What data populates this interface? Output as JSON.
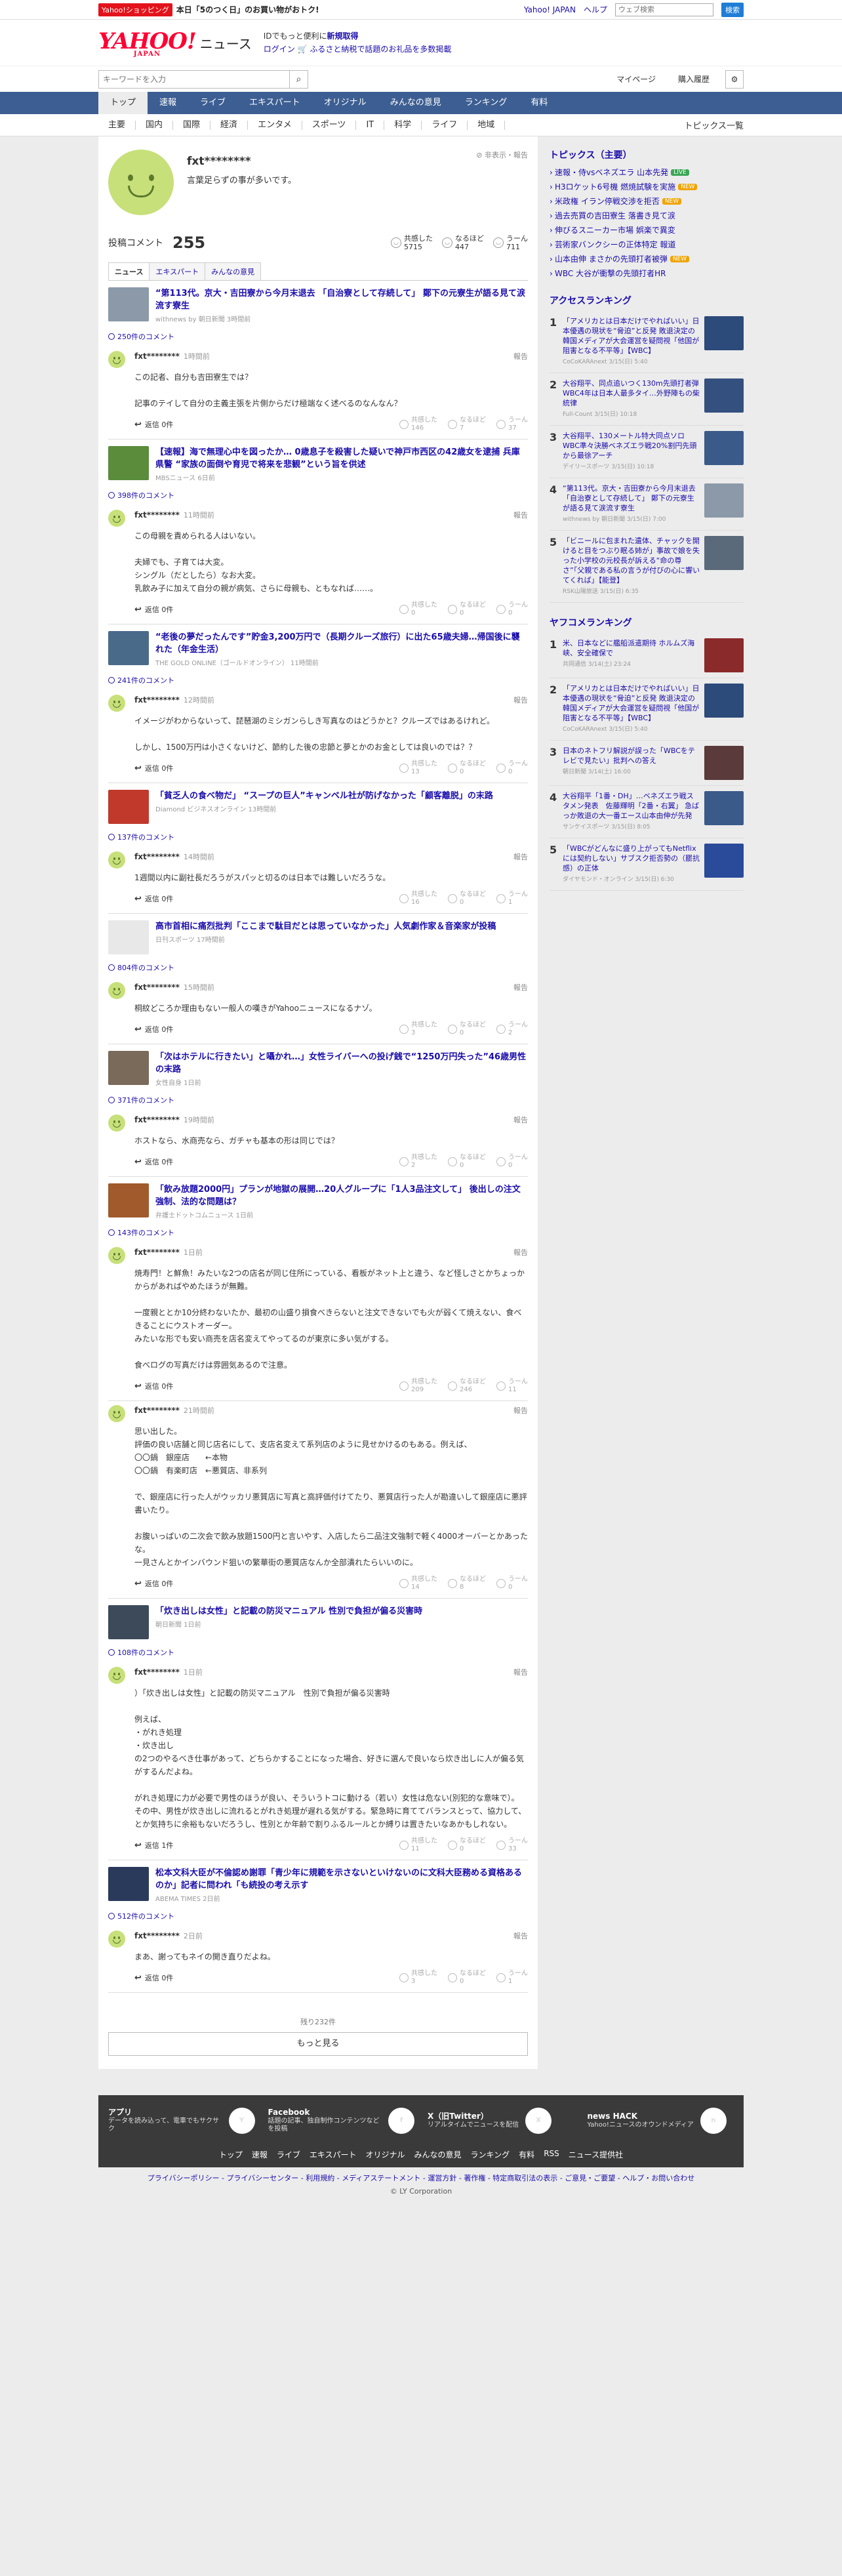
{
  "topbar": {
    "shop_tag": "Yahoo!ショッピング",
    "promo": "本日「5のつく日」のお買い物がおトク!",
    "links": [
      "Yahoo! JAPAN",
      "ヘルプ"
    ],
    "search_placeholder": "ウェブ検索",
    "search_btn": "検索"
  },
  "header": {
    "logo": "YAHOO!",
    "logo_sub": "JAPAN",
    "section": "ニュース",
    "login_line1_pre": "IDでもっと便利に",
    "login_line1_link": "新規取得",
    "login_line2_link": "ログイン",
    "login_line2_rest": "ふるさと納税で話題のお礼品を多数掲載"
  },
  "search": {
    "placeholder": "キーワードを入力",
    "mypage": "マイページ",
    "history": "購入履歴"
  },
  "nav": [
    "トップ",
    "速報",
    "ライブ",
    "エキスパート",
    "オリジナル",
    "みんなの意見",
    "ランキング",
    "有料"
  ],
  "subnav": [
    "主要",
    "国内",
    "国際",
    "経済",
    "エンタメ",
    "スポーツ",
    "IT",
    "科学",
    "ライフ",
    "地域"
  ],
  "subnav_right": "トピックス一覧",
  "profile": {
    "name": "fxt********",
    "bio": "言葉足らずの事が多いです。",
    "report": "非表示・報告",
    "count_label": "投稿コメント",
    "count": "255"
  },
  "profile_reacts": [
    {
      "label": "共感した",
      "value": "5715"
    },
    {
      "label": "なるほど",
      "value": "447"
    },
    {
      "label": "うーん",
      "value": "711"
    }
  ],
  "comment_tabs": [
    "ニュース",
    "エキスパート",
    "みんなの意見"
  ],
  "react_labels": [
    "共感した",
    "なるほど",
    "うーん"
  ],
  "entries": [
    {
      "title": "“第113代。京大・吉田寮から今月末退去 「自治寮として存続して」 鄭下の元寮生が語る見て涙流す寮生",
      "source": "withnews by 朝日新聞 3時間前",
      "thumb": "#8b99a8",
      "count": "250件のコメント",
      "user": "fxt********",
      "time": "1時間前",
      "text": "この記者、自分も吉田寮生では？\n\n記事のテイして自分の主義主張を片側からだけ極端なく述べるのなんなん？",
      "replies": "返信 0件",
      "r": [
        "146",
        "7",
        "37"
      ]
    },
    {
      "title": "【速報】海で無理心中を図ったか… 0歳息子を殺害した疑いで神戸市西区の42歳女を逮捕 兵庫県警 “家族の面倒や育児で将来を悲観”という旨を供述",
      "source": "MBSニュース 6日前",
      "thumb": "#5a8c3c",
      "count": "398件のコメント",
      "user": "fxt********",
      "time": "11時間前",
      "text": "この母親を責められる人はいない。\n\n夫婦でも、子育ては大変。\nシングル（だとしたら）なお大変。\n乳飲み子に加えて自分の親が病気、さらに母親も、ともなれば……。",
      "replies": "返信 0件",
      "r": [
        "0",
        "0",
        "0"
      ]
    },
    {
      "title": "“老後の夢だったんです”貯金3,200万円で（長期クルーズ旅行）に出た65歳夫婦…帰国後に襲れた（年金生活）",
      "source": "THE GOLD ONLINE（ゴールドオンライン） 11時間前",
      "thumb": "#4a6a8a",
      "count": "241件のコメント",
      "user": "fxt********",
      "time": "12時間前",
      "text": "イメージがわからないって、琵琶湖のミシガンらしき写真なのはどうかと？クルーズではあるけれど。\n\nしかし、1500万円は小さくないけど、節約した後の忠節と夢とかのお金としては良いのでは？？",
      "replies": "返信 0件",
      "r": [
        "13",
        "0",
        "0"
      ]
    },
    {
      "title": "「貧乏人の食べ物だ」 “スープの巨人”キャンベル社が防げなかった「顧客離脱」の末路",
      "source": "Diamond ビジネスオンライン 13時間前",
      "thumb": "#c0392b",
      "count": "137件のコメント",
      "user": "fxt********",
      "time": "14時間前",
      "text": "1週間以内に副社長だろうがスパッと切るのは日本では難しいだろうな。",
      "replies": "返信 0件",
      "r": [
        "16",
        "0",
        "1"
      ]
    },
    {
      "title": "高市首相に痛烈批判「ここまで駄目だとは思っていなかった」人気劇作家＆音楽家が投稿",
      "source": "日刊スポーツ 17時間前",
      "thumb": "#e8e8e8",
      "count": "804件のコメント",
      "user": "fxt********",
      "time": "15時間前",
      "text": "桐紋どころか理由もない一般人の嘆きがYahooニュースになるナゾ。",
      "replies": "返信 0件",
      "r": [
        "3",
        "0",
        "2"
      ]
    },
    {
      "title": "「次はホテルに行きたい」と囁かれ…」女性ライバーへの投げ銭で“1250万円失った”46歳男性の末路",
      "source": "女性自身 1日前",
      "thumb": "#7a6a5a",
      "count": "371件のコメント",
      "user": "fxt********",
      "time": "19時間前",
      "text": "ホストなら、水商売なら、ガチャも基本の形は同じでは？",
      "replies": "返信 0件",
      "r": [
        "2",
        "0",
        "0"
      ]
    },
    {
      "title": "「飲み放題2000円」プランが地獄の展開…20人グループに「1人3品注文して」 後出しの注文強制、法的な問題は？",
      "source": "弁護士ドットコムニュース 1日前",
      "thumb": "#a05a2c",
      "count": "143件のコメント",
      "user": "fxt********",
      "time": "1日前",
      "text": "焼寿門！と鮮魚！みたいな2つの店名が同じ住所にっている、看板がネット上と違う、など怪しさとかちょっかからがあればやめたほうが無難。\n\n一度親ととか10分終わないたか、最初の山盛り損食べきらないと注文できないでも火が弱くて焼えない、食べきることにウストオーダー。\nみたいな形でも安い商売を店名変えてやってるのが東京に多い気がする。\n\n食べログの写真だけは雰囲気あるので注意。",
      "replies": "返信 0件",
      "r": [
        "209",
        "246",
        "11"
      ]
    },
    {
      "title": "",
      "source": "",
      "thumb": "",
      "count": "",
      "user": "fxt********",
      "time": "21時間前",
      "text": "思い出した。\n評価の良い店舗と同じ店名にして、支店名変えて系列店のように見せかけるのもある。例えば、\n〇〇鍋　銀座店　　←本物\n〇〇鍋　有楽町店　←悪質店、非系列\n\nで、銀座店に行った人がウッカリ悪質店に写真と高評価付けてたり、悪質店行った人が勘違いして銀座店に悪評書いたり。\n\nお腹いっぱいの二次会で飲み放題1500円と言いやす、入店したら二品注文強制で軽く4000オーバーとかあったな。\n一見さんとかインバウンド狙いの繁華街の悪質店なんか全部潰れたらいいのに。",
      "replies": "返信 0件",
      "r": [
        "14",
        "8",
        "0"
      ]
    },
    {
      "title": "「炊き出しは女性」と記載の防災マニュアル 性別で負担が偏る災害時",
      "source": "朝日新聞 1日前",
      "thumb": "#3c4a5a",
      "count": "108件のコメント",
      "user": "fxt********",
      "time": "1日前",
      "text": "）「炊き出しは女性」と記載の防災マニュアル　性別で負担が偏る災害時\n\n例えば、\n・がれき処理\n・炊き出し\nの2つのやるべき仕事があって、どちらかすることになった場合、好きに選んで良いなら炊き出しに人が偏る気がするんだよね。\n\nがれき処理に力が必要で男性のほうが良い、そういうトコに動ける（若い）女性は危ない(別犯的な意味で）。\nその中、男性が炊き出しに流れるとがれき処理が遅れる気がする。緊急時に育ててバランスとって、協力して、とか気持ちに余裕もないだろうし、性別とか年齢で割りふるルールとか縛りは置きたいなあかもしれない。",
      "replies": "返信 1件",
      "r": [
        "11",
        "0",
        "33"
      ]
    },
    {
      "title": "松本文科大臣が不倫認め謝罪「青少年に規範を示さないといけないのに文科大臣務める資格あるのか」記者に問われ「も続投の考え示す",
      "source": "ABEMA TIMES 2日前",
      "thumb": "#2a3a5a",
      "count": "512件のコメント",
      "user": "fxt********",
      "time": "2日前",
      "text": "まあ、謝ってもネイの開き直りだよね。",
      "replies": "返信 0件",
      "r": [
        "3",
        "0",
        "1"
      ]
    }
  ],
  "more": {
    "remaining": "残り232件",
    "button": "もっと見る"
  },
  "topics": {
    "title": "トピックス（主要）",
    "items": [
      {
        "t": "速報・侍vsベネズエラ 山本先発",
        "b": "LIVE",
        "c": "#3aa655"
      },
      {
        "t": "H3ロケット6号機 燃焼試験を実施",
        "b": "NEW",
        "c": "#f0a400"
      },
      {
        "t": "米政権 イラン停戦交渉を拒否",
        "b": "NEW",
        "c": "#f0a400"
      },
      {
        "t": "過去売買の吉田寮生 落書き見て涙",
        "b": "",
        "c": ""
      },
      {
        "t": "伸びるスニーカー市場 娯楽で異変",
        "b": "",
        "c": ""
      },
      {
        "t": "芸術家バンクシーの正体特定 報道",
        "b": "",
        "c": ""
      },
      {
        "t": "山本由伸 まさかの先頭打者被弾",
        "b": "NEW",
        "c": "#f0a400"
      },
      {
        "t": "WBC 大谷が衝撃の先頭打者HR",
        "b": "",
        "c": ""
      }
    ]
  },
  "access": {
    "title": "アクセスランキング",
    "items": [
      {
        "n": "1",
        "t": "「アメリカとは日本だけでやればいい」日本優遇の現状を“脅迫”と反発 敗退決定の韓国メディアが大会運営を疑問視「他国が阻害となる不平等」【WBC】",
        "s": "CoCoKARAnext 3/15(日) 5:40",
        "c": "#2c4a7a"
      },
      {
        "n": "2",
        "t": "大谷翔平、同点追いつく130m先頭打者弾 WBC4年は日本人最多タイ…外野陣もの柴統律",
        "s": "Full-Count 3/15(日) 10:18",
        "c": "#34507e"
      },
      {
        "n": "3",
        "t": "大谷翔平、130メートル特大同点ソロ WBC準々決勝ベネズエラ戦20%割円先頭から最徐アーチ",
        "s": "デイリースポーツ 3/15(日) 10:18",
        "c": "#3a5a8a"
      },
      {
        "n": "4",
        "t": "“第113代。京大・吉田寮から今月末退去「自治寮として存続して」 鄭下の元寮生が語る見て涙流す寮生",
        "s": "withnews by 朝日新聞 3/15(日) 7:00",
        "c": "#8b99a8"
      },
      {
        "n": "5",
        "t": "「ビニールに包まれた遺体、チャックを開けると目をつぶり眠る姉が」事故で娘を失った小学校の元校長が訴える“命の尊さ”「父親である私の言うが付びの心に響いてくれば」【能登】",
        "s": "RSK山陽放送 3/15(日) 6:35",
        "c": "#5a6a7a"
      }
    ]
  },
  "yahoo_ranking": {
    "title": "ヤフコメランキング",
    "items": [
      {
        "n": "1",
        "t": "米、日本などに艦船派遣期待 ホルムズ海峡、安全確保で",
        "s": "共同通信 3/14(土) 23:24",
        "c": "#8a2a2a"
      },
      {
        "n": "2",
        "t": "「アメリカとは日本だけでやればいい」日本優遇の現状を“脅迫”と反発 敗退決定の韓国メディアが大会運営を疑問視「他国が阻害となる不平等」【WBC】",
        "s": "CoCoKARAnext 3/15(日) 5:40",
        "c": "#2c4a7a"
      },
      {
        "n": "3",
        "t": "日本のネトフリ解説が誤った「WBCをテレビで見たい」批判への答え",
        "s": "朝日新聞 3/14(土) 16:00",
        "c": "#5a3a3a"
      },
      {
        "n": "4",
        "t": "大谷翔平「1番・DH」…ベネズエラ戦スタメン発表　佐藤輝明「2番・右翼」 急ばっか敗退の大一番エース山本由伸が先発",
        "s": "サンケイスポーツ 3/15(日) 8:05",
        "c": "#3a5a8a"
      },
      {
        "n": "5",
        "t": "「WBCがどんなに盛り上がってもNetflixには契約しない」サブスク拒否勢の（罷抗感）の正体",
        "s": "ダイヤモンド・オンライン 3/15(日) 6:30",
        "c": "#2a4a9a"
      }
    ]
  },
  "footer": {
    "cols": [
      {
        "t": "アプリ",
        "d": "データを読み込って、電車でもサクサク",
        "i": "Y"
      },
      {
        "t": "Facebook",
        "d": "話題の記事、独自制作コンテンツなどを投稿",
        "i": "f"
      },
      {
        "t": "X（旧Twitter）",
        "d": "リアルタイムでニュースを配信",
        "i": "X"
      },
      {
        "t": "news HACK",
        "d": "Yahoo!ニュースのオウンドメディア",
        "i": "n"
      }
    ],
    "nav": [
      "トップ",
      "速報",
      "ライブ",
      "エキスパート",
      "オリジナル",
      "みんなの意見",
      "ランキング",
      "有料",
      "RSS",
      "ニュース提供社"
    ],
    "links": "プライバシーポリシー - プライバシーセンター - 利用規約 - メディアステートメント - 運営方針 - 著作権 - 特定商取引法の表示 - ご意見・ご要望 - ヘルプ・お問い合わせ",
    "copy": "© LY Corporation"
  }
}
